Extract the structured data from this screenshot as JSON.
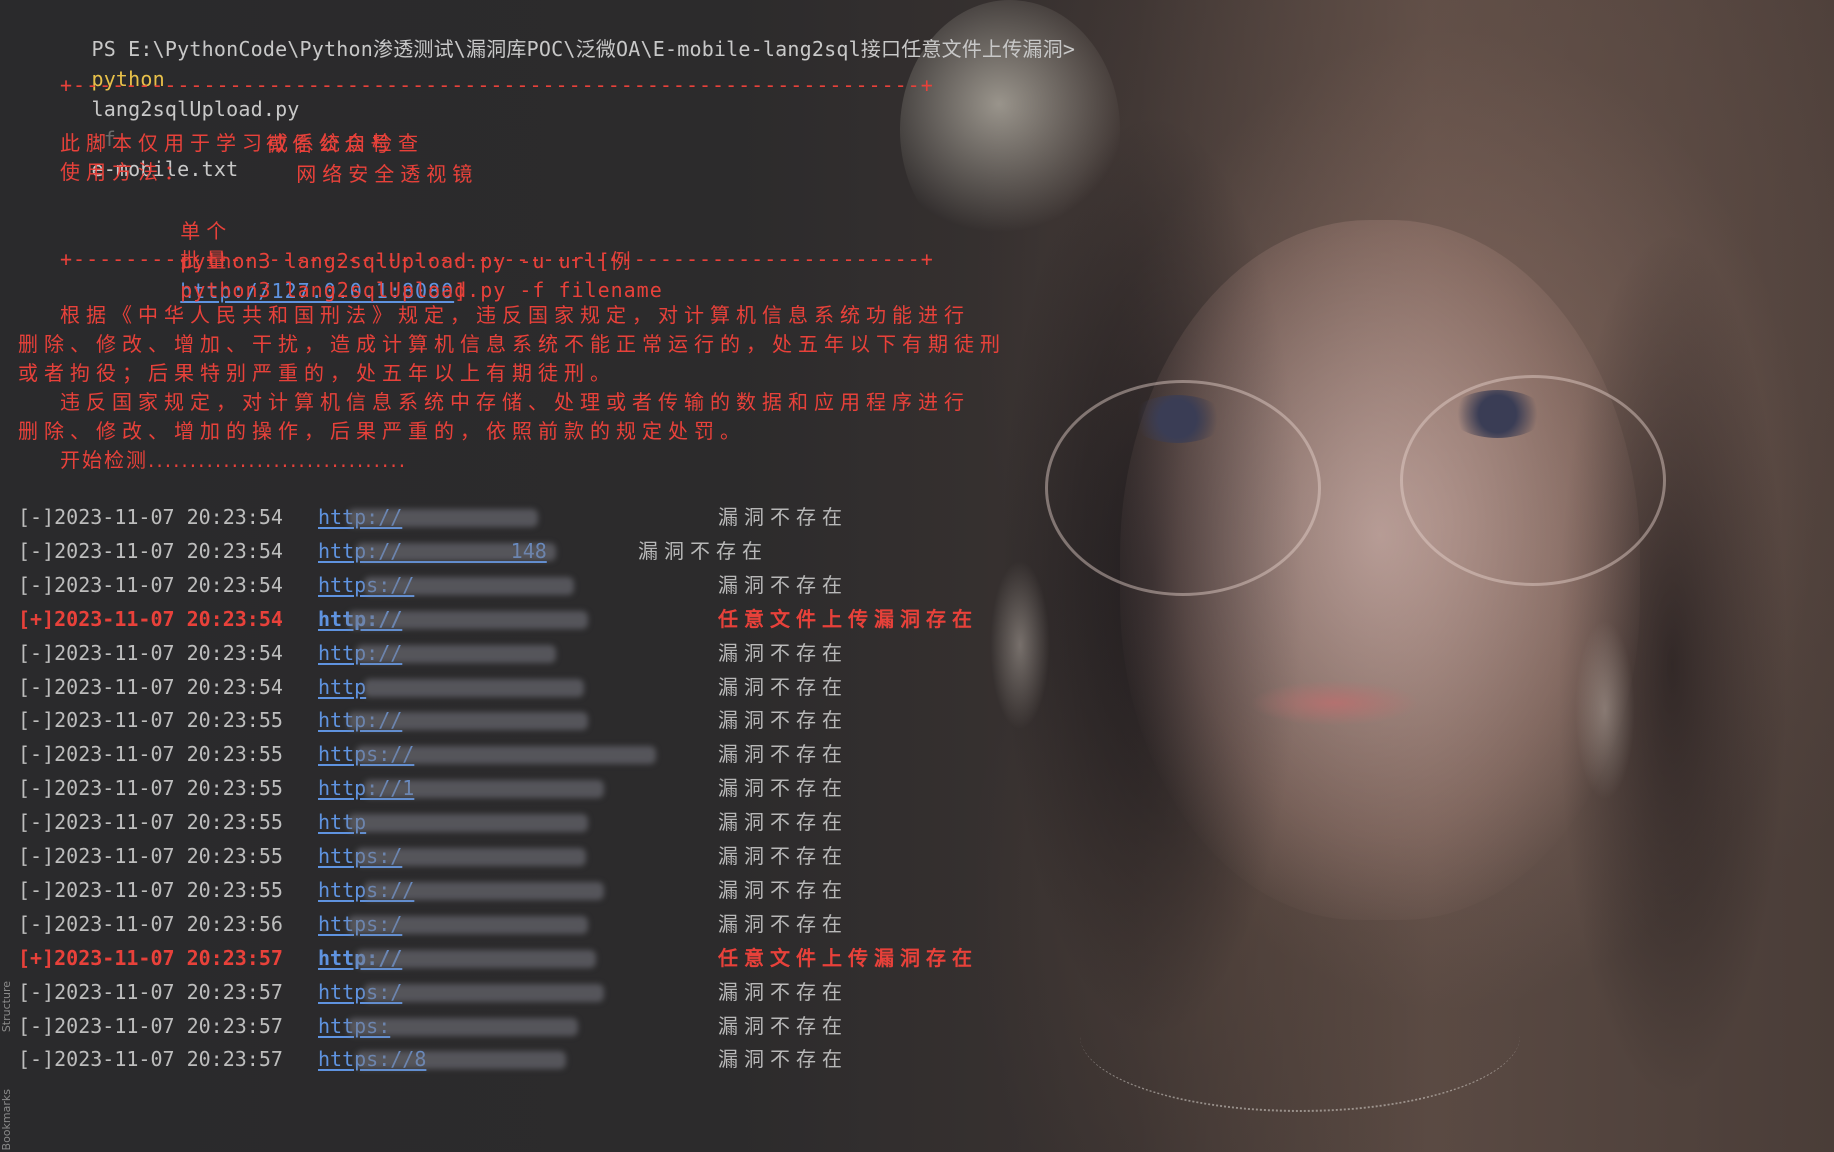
{
  "command": {
    "prompt": "PS E:\\PythonCode\\Python渗透测试\\漏洞库POC\\泛微OA\\E-mobile-lang2sql接口任意文件上传漏洞>",
    "program": "python",
    "script": "lang2sqlUpload.py",
    "flag": "-f",
    "argument": "e-mobile.txt"
  },
  "banner": {
    "border": "+-----------------------------------------------------------------+",
    "wechat_label": "微信公众号",
    "wechat_name": "网络安全透视镜",
    "disclaimer": "此脚本仅用于学习或系统自检查",
    "usage_title": "使用方法：",
    "single_label": "单个",
    "single_cmd": "python3 lang2sqlUpload.py -u url[例",
    "single_example_url": "http://127.0.0.1:8080",
    "single_close": "]",
    "batch_label": "批量",
    "batch_cmd": "python3 lang2sqlUpload.py -f filename"
  },
  "law": {
    "line1": "根据《中华人民共和国刑法》规定，违反国家规定，对计算机信息系统功能进行",
    "line2": "删除、修改、增加、干扰，造成计算机信息系统不能正常运行的，处五年以下有期徒刑",
    "line3": "或者拘役；后果特别严重的，处五年以上有期徒刑。",
    "line4": "违反国家规定，对计算机信息系统中存储、处理或者传输的数据和应用程序进行",
    "line5": "删除、修改、增加的操作，后果严重的，依照前款的规定处罚。",
    "start": "开始检测..............................."
  },
  "results": [
    {
      "prefix": "[-]",
      "timestamp": "2023-11-07 20:23:54",
      "url": "http://",
      "status": "漏洞不存在",
      "hit": false
    },
    {
      "prefix": "[-]",
      "timestamp": "2023-11-07 20:23:54",
      "url": "http://         148",
      "status": "漏洞不存在",
      "hit": false
    },
    {
      "prefix": "[-]",
      "timestamp": "2023-11-07 20:23:54",
      "url": "https://",
      "status": "漏洞不存在",
      "hit": false
    },
    {
      "prefix": "[+]",
      "timestamp": "2023-11-07 20:23:54",
      "url": "http://",
      "status": "任意文件上传漏洞存在",
      "hit": true
    },
    {
      "prefix": "[-]",
      "timestamp": "2023-11-07 20:23:54",
      "url": "http://",
      "status": "漏洞不存在",
      "hit": false
    },
    {
      "prefix": "[-]",
      "timestamp": "2023-11-07 20:23:54",
      "url": "http",
      "status": "漏洞不存在",
      "hit": false
    },
    {
      "prefix": "[-]",
      "timestamp": "2023-11-07 20:23:55",
      "url": "http://",
      "status": "漏洞不存在",
      "hit": false
    },
    {
      "prefix": "[-]",
      "timestamp": "2023-11-07 20:23:55",
      "url": "https://",
      "status": "漏洞不存在",
      "hit": false
    },
    {
      "prefix": "[-]",
      "timestamp": "2023-11-07 20:23:55",
      "url": "http://1",
      "status": "漏洞不存在",
      "hit": false
    },
    {
      "prefix": "[-]",
      "timestamp": "2023-11-07 20:23:55",
      "url": "http",
      "status": "漏洞不存在",
      "hit": false
    },
    {
      "prefix": "[-]",
      "timestamp": "2023-11-07 20:23:55",
      "url": "https:/",
      "status": "漏洞不存在",
      "hit": false
    },
    {
      "prefix": "[-]",
      "timestamp": "2023-11-07 20:23:55",
      "url": "https://",
      "status": "漏洞不存在",
      "hit": false
    },
    {
      "prefix": "[-]",
      "timestamp": "2023-11-07 20:23:56",
      "url": "https:/",
      "status": "漏洞不存在",
      "hit": false
    },
    {
      "prefix": "[+]",
      "timestamp": "2023-11-07 20:23:57",
      "url": "http://",
      "status": "任意文件上传漏洞存在",
      "hit": true
    },
    {
      "prefix": "[-]",
      "timestamp": "2023-11-07 20:23:57",
      "url": "https:/",
      "status": "漏洞不存在",
      "hit": false
    },
    {
      "prefix": "[-]",
      "timestamp": "2023-11-07 20:23:57",
      "url": "https:",
      "status": "漏洞不存在",
      "hit": false
    },
    {
      "prefix": "[-]",
      "timestamp": "2023-11-07 20:23:57",
      "url": "https://8",
      "status": "漏洞不存在",
      "hit": false
    }
  ],
  "side_tabs": {
    "structure": "Structure",
    "bookmarks": "Bookmarks"
  },
  "colors": {
    "accent_red": "#e8413a",
    "link_blue": "#5f93e0",
    "command_yellow": "#e8c14a"
  }
}
